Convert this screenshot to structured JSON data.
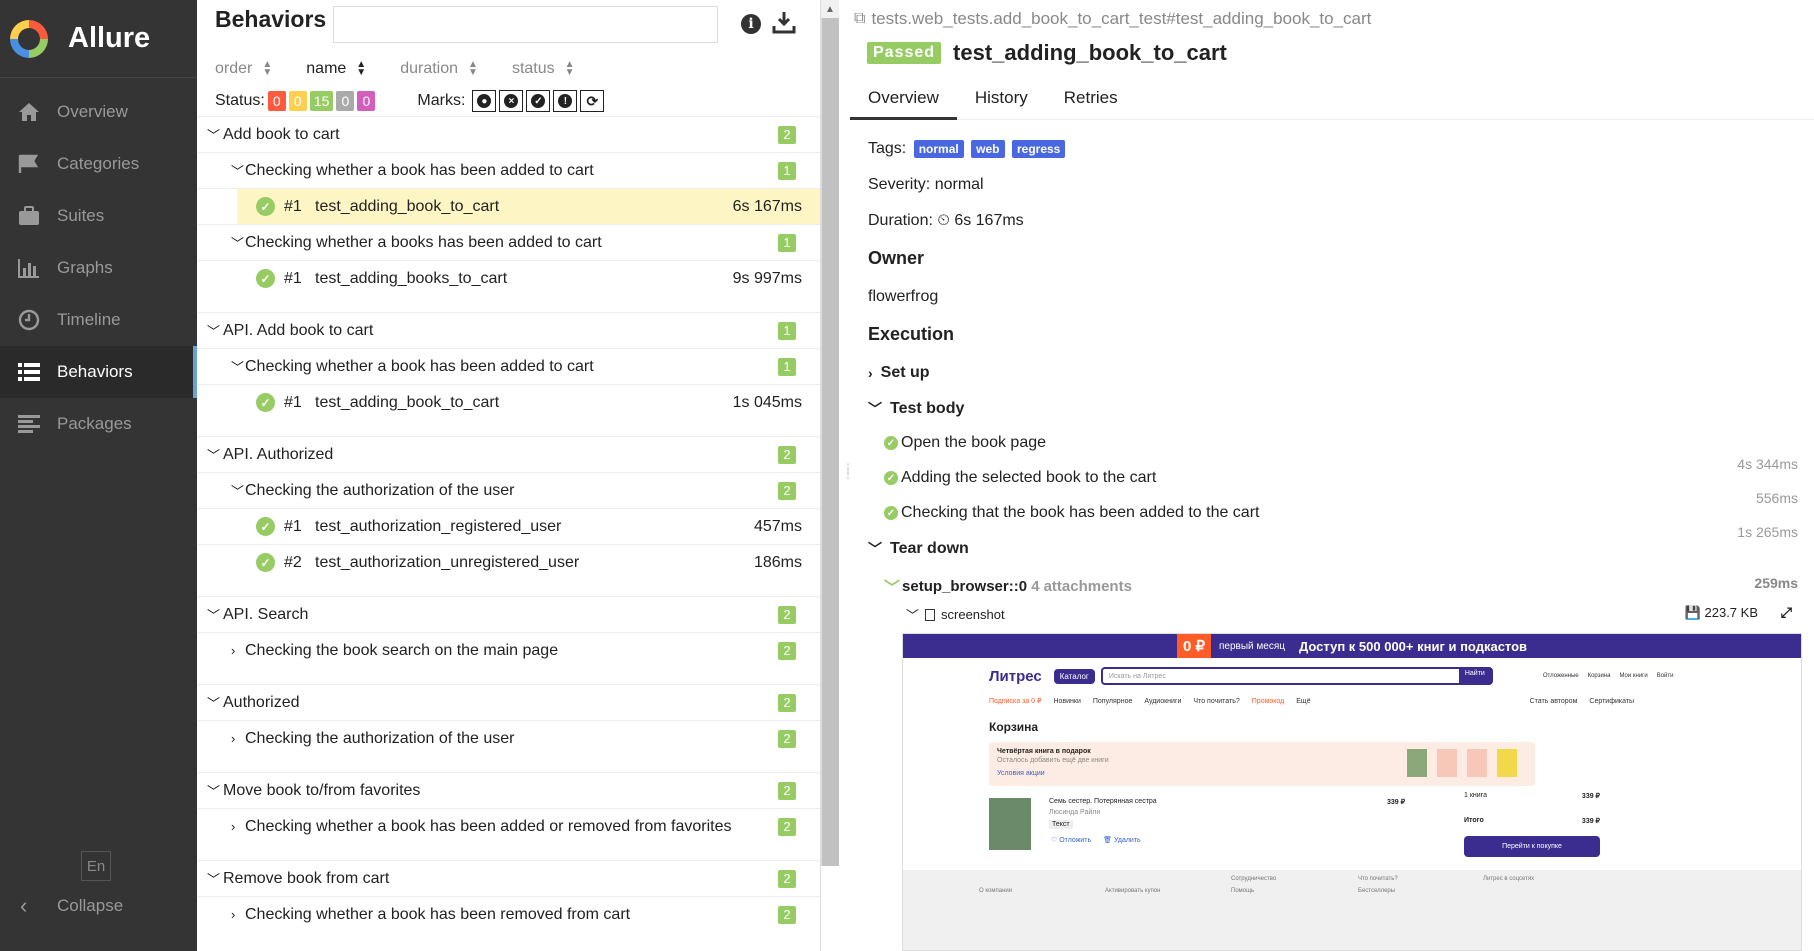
{
  "sidebar": {
    "brand": "Allure",
    "items": [
      {
        "label": "Overview",
        "icon": "home-icon"
      },
      {
        "label": "Categories",
        "icon": "flag-icon"
      },
      {
        "label": "Suites",
        "icon": "briefcase-icon"
      },
      {
        "label": "Graphs",
        "icon": "bar-chart-icon"
      },
      {
        "label": "Timeline",
        "icon": "clock-icon"
      },
      {
        "label": "Behaviors",
        "icon": "list-icon",
        "active": true
      },
      {
        "label": "Packages",
        "icon": "align-left-icon"
      }
    ],
    "language": "En",
    "collapse": "Collapse"
  },
  "behaviors": {
    "title": "Behaviors",
    "search_value": "",
    "sort": {
      "order": "order",
      "name": "name",
      "duration": "duration",
      "status": "status"
    },
    "status_label": "Status:",
    "status_counts": {
      "failed": "0",
      "broken": "0",
      "passed": "15",
      "skipped": "0",
      "unknown": "0"
    },
    "marks_label": "Marks:",
    "groups": [
      {
        "label": "Add book to cart",
        "count": "2",
        "children": [
          {
            "label": "Checking whether a book has been added to cart",
            "count": "1",
            "expanded": true,
            "tests": [
              {
                "num": "#1",
                "name": "test_adding_book_to_cart",
                "duration": "6s 167ms",
                "selected": true
              }
            ]
          },
          {
            "label": "Checking whether a books has been added to cart",
            "count": "1",
            "expanded": true,
            "tests": [
              {
                "num": "#1",
                "name": "test_adding_books_to_cart",
                "duration": "9s 997ms"
              }
            ]
          }
        ]
      },
      {
        "label": "API. Add book to cart",
        "count": "1",
        "children": [
          {
            "label": "Checking whether a book has been added to cart",
            "count": "1",
            "expanded": true,
            "tests": [
              {
                "num": "#1",
                "name": "test_adding_book_to_cart",
                "duration": "1s 045ms"
              }
            ]
          }
        ]
      },
      {
        "label": "API. Authorized",
        "count": "2",
        "children": [
          {
            "label": "Checking the authorization of the user",
            "count": "2",
            "expanded": true,
            "tests": [
              {
                "num": "#1",
                "name": "test_authorization_registered_user",
                "duration": "457ms"
              },
              {
                "num": "#2",
                "name": "test_authorization_unregistered_user",
                "duration": "186ms"
              }
            ]
          }
        ]
      },
      {
        "label": "API. Search",
        "count": "2",
        "children": [
          {
            "label": "Checking the book search on the main page",
            "count": "2",
            "expanded": false,
            "tests": []
          }
        ]
      },
      {
        "label": "Authorized",
        "count": "2",
        "children": [
          {
            "label": "Checking the authorization of the user",
            "count": "2",
            "expanded": false,
            "tests": []
          }
        ]
      },
      {
        "label": "Move book to/from favorites",
        "count": "2",
        "children": [
          {
            "label": "Checking whether a book has been added or removed from favorites",
            "count": "2",
            "expanded": false,
            "tests": []
          }
        ]
      },
      {
        "label": "Remove book from cart",
        "count": "2",
        "children": [
          {
            "label": "Checking whether a book has been removed from cart",
            "count": "2",
            "expanded": false,
            "tests": []
          }
        ]
      }
    ]
  },
  "detail": {
    "breadcrumb": "tests.web_tests.add_book_to_cart_test#test_adding_book_to_cart",
    "status": "Passed",
    "title": "test_adding_book_to_cart",
    "tabs": [
      "Overview",
      "History",
      "Retries"
    ],
    "tags_label": "Tags:",
    "tags": [
      "normal",
      "web",
      "regress"
    ],
    "severity": "Severity: normal",
    "duration_label": "Duration:",
    "duration": "6s 167ms",
    "owner_heading": "Owner",
    "owner": "flowerfrog",
    "execution_heading": "Execution",
    "setup": "Set up",
    "test_body": "Test body",
    "steps": [
      {
        "label": "Open the book page",
        "duration": "4s 344ms"
      },
      {
        "label": "Adding the selected book to the cart",
        "duration": "556ms"
      },
      {
        "label": "Checking that the book has been added to the cart",
        "duration": "1s 265ms"
      }
    ],
    "teardown": "Tear down",
    "fixture": "setup_browser::0",
    "fixture_attachments": "4 attachments",
    "fixture_duration": "259ms",
    "attachment_name": "screenshot",
    "attachment_size": "223.7 KB",
    "screenshot": {
      "banner_price": "0 ₽",
      "banner_first": "первый месяц",
      "banner_text": "Доступ к 500 000+ книг и подкастов",
      "logo": "Литрес",
      "catalog": "Каталог",
      "search_placeholder": "Искать на Литрес",
      "find": "Найти",
      "header_icons": [
        "Отложенные",
        "Корзина",
        "Мои книги",
        "Войти"
      ],
      "nav": [
        "Подписка за 0 ₽",
        "Новинки",
        "Популярное",
        "Аудиокниги",
        "Что почитать?",
        "Промокод",
        "Ещё"
      ],
      "nav_right": [
        "Стать автором",
        "Сертификаты"
      ],
      "cart_title": "Корзина",
      "gift_title": "Четвёртая книга в подарок",
      "gift_sub": "Осталось добавить ещё две книги",
      "gift_link": "Условия акции",
      "item_title": "Семь сестер. Потерянная сестра",
      "item_author": "Люсинда Райли",
      "item_chip": "Текст",
      "item_postpone": "Отложить",
      "item_delete": "Удалить",
      "item_price": "339 ₽",
      "summary_count": "1 книга",
      "summary_price": "339 ₽",
      "summary_total_label": "Итого",
      "summary_total": "339 ₽",
      "checkout": "Перейти к покупке",
      "footer": [
        "О компании",
        "Активировать купон",
        "Сотрудничество",
        "Помощь",
        "Что почитать?",
        "Бестселлеры",
        "Литрес в соцсетях"
      ]
    }
  }
}
